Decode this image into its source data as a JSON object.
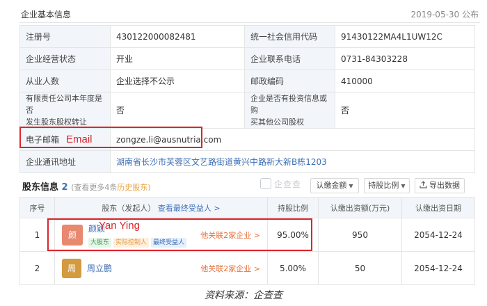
{
  "header": {
    "title": "企业基本信息",
    "date": "2019-05-30 公布"
  },
  "info": {
    "reg_no_label": "注册号",
    "reg_no": "430122000082481",
    "credit_code_label": "统一社会信用代码",
    "credit_code": "91430122MA4L1UW12C",
    "status_label": "企业经营状态",
    "status": "开业",
    "phone_label": "企业联系电话",
    "phone": "0731-84303228",
    "employees_label": "从业人数",
    "employees": "企业选择不公示",
    "postcode_label": "邮政编码",
    "postcode": "410000",
    "transfer_label_1": "有限责任公司本年度是否",
    "transfer_label_2": "发生股东股权转让",
    "transfer": "否",
    "invest_label_1": "企业是否有投资信息或购",
    "invest_label_2": "买其他公司股权",
    "invest": "否",
    "email_label": "电子邮箱",
    "email": "zongze.li@ausnutria.com",
    "address_label": "企业通讯地址",
    "address": "湖南省长沙市芙蓉区文艺路街道黄兴中路新大新B栋1203"
  },
  "annotations": {
    "email": "Email",
    "name": "Yan Ying"
  },
  "shareholders": {
    "title": "股东信息",
    "count": "2",
    "more": "(查看更多4条",
    "history": "历史股东)",
    "watermark": "企查查",
    "btn_amount": "认缴金额",
    "btn_ratio": "持股比例",
    "btn_export": "导出数据",
    "headers": {
      "no": "序号",
      "holder": "股东（发起人）",
      "beneficial": "查看最终受益人 >",
      "ratio": "持股比例",
      "amount": "认缴出资额(万元)",
      "date": "认缴出资日期"
    },
    "rows": [
      {
        "no": "1",
        "avatar": "颜",
        "avatar_color": "#e8886f",
        "name": "颜颖",
        "tags": [
          "大股东",
          "实际控制人",
          "最终受益人"
        ],
        "related": "他关联2家企业 >",
        "ratio": "95.00%",
        "amount": "950",
        "date": "2054-12-24"
      },
      {
        "no": "2",
        "avatar": "周",
        "avatar_color": "#d39a3f",
        "name": "周立鹏",
        "tags": [],
        "related": "他关联2家企业 >",
        "ratio": "5.00%",
        "amount": "50",
        "date": "2054-12-24"
      }
    ]
  },
  "caption": "资料来源：企查查"
}
